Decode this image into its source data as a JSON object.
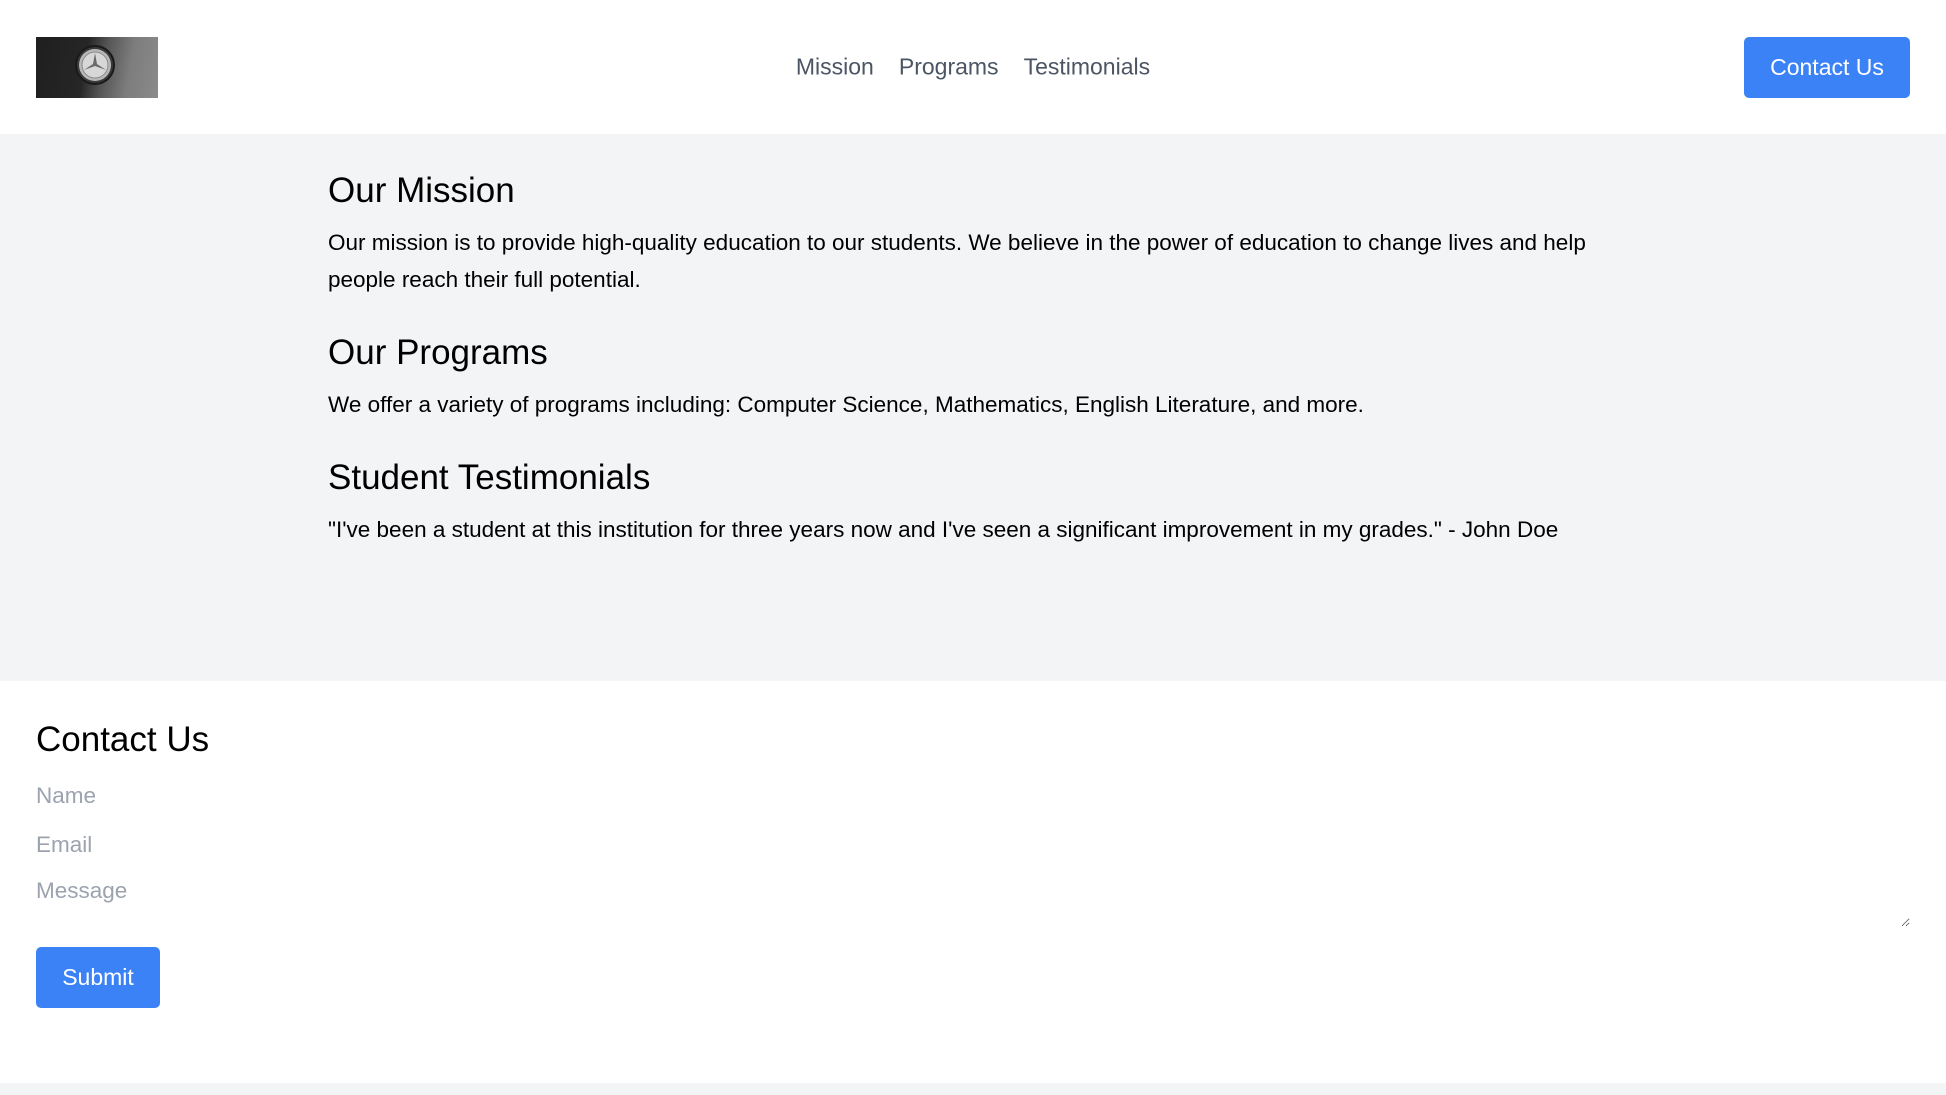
{
  "header": {
    "logo_alt": "Institution logo - car emblem photo",
    "nav": [
      {
        "label": "Mission"
      },
      {
        "label": "Programs"
      },
      {
        "label": "Testimonials"
      }
    ],
    "contact_button": "Contact Us"
  },
  "sections": [
    {
      "title": "Our Mission",
      "body": "Our mission is to provide high-quality education to our students. We believe in the power of education to change lives and help people reach their full potential."
    },
    {
      "title": "Our Programs",
      "body": "We offer a variety of programs including: Computer Science, Mathematics, English Literature, and more."
    },
    {
      "title": "Student Testimonials",
      "body": "\"I've been a student at this institution for three years now and I've seen a significant improvement in my grades.\" - John Doe"
    }
  ],
  "contact": {
    "title": "Contact Us",
    "name_placeholder": "Name",
    "email_placeholder": "Email",
    "message_placeholder": "Message",
    "submit_label": "Submit"
  },
  "colors": {
    "accent": "#3b82f6",
    "page_bg": "#f3f4f6",
    "nav_text": "#4b5563",
    "placeholder": "#9ca3af"
  }
}
